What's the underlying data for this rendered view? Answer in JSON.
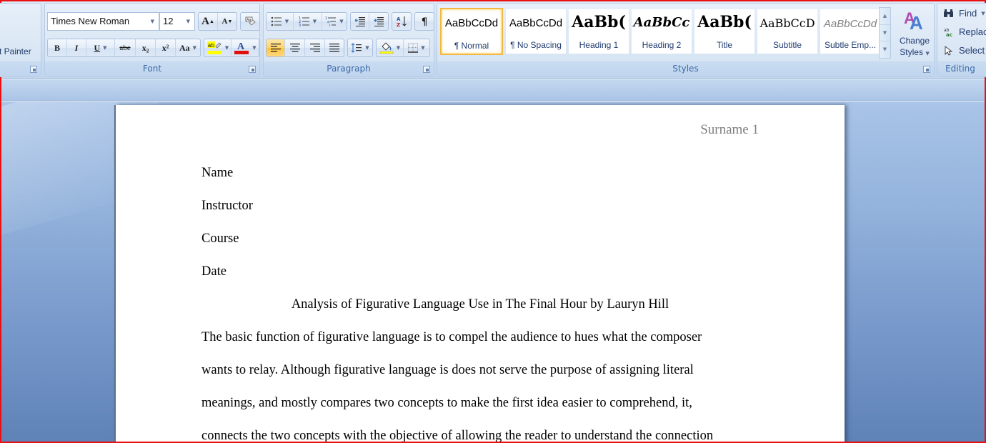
{
  "ribbon": {
    "clipboard": {
      "format_painter_label": "t Painter"
    },
    "font": {
      "label": "Font",
      "font_name": "Times New Roman",
      "font_size": "12",
      "grow_font": "A",
      "shrink_font": "A",
      "bold": "B",
      "italic": "I",
      "underline": "U",
      "strikethrough": "abe",
      "subscript": "x₂",
      "superscript": "x²",
      "change_case": "Aa",
      "highlight_color": "#ffff00",
      "font_color": "#e01010"
    },
    "paragraph": {
      "label": "Paragraph",
      "active_alignment": "align-left",
      "shading_color": "#ffff00"
    },
    "styles": {
      "label": "Styles",
      "items": [
        {
          "sample": "AaBbCcDd",
          "name": "¶ Normal",
          "selected": true
        },
        {
          "sample": "AaBbCcDd",
          "name": "¶ No Spacing",
          "selected": false
        },
        {
          "sample": "AaBb(",
          "name": "Heading 1",
          "selected": false
        },
        {
          "sample": "AaBbCc",
          "name": "Heading 2",
          "selected": false
        },
        {
          "sample": "AaBb(",
          "name": "Title",
          "selected": false
        },
        {
          "sample": "AaBbCcD",
          "name": "Subtitle",
          "selected": false
        },
        {
          "sample": "AaBbCcDd",
          "name": "Subtle Emp...",
          "selected": false
        }
      ],
      "change_styles_line1": "Change",
      "change_styles_line2": "Styles"
    },
    "editing": {
      "label": "Editing",
      "find": "Find",
      "replace": "Replac",
      "select": "Select"
    }
  },
  "document": {
    "header": "Surname 1",
    "lines": {
      "name": "Name",
      "instructor": "Instructor",
      "course": "Course",
      "date": "Date"
    },
    "title": "Analysis of Figurative Language Use in The Final Hour by Lauryn Hill",
    "body": [
      "The basic function of figurative language is to compel the audience to hues what the composer",
      "wants to relay. Although figurative language is does not serve the purpose of assigning literal",
      "meanings, and mostly compares two concepts to make the first idea easier to comprehend, it,",
      "connects the two concepts with the objective of allowing the reader to understand the connection"
    ]
  }
}
